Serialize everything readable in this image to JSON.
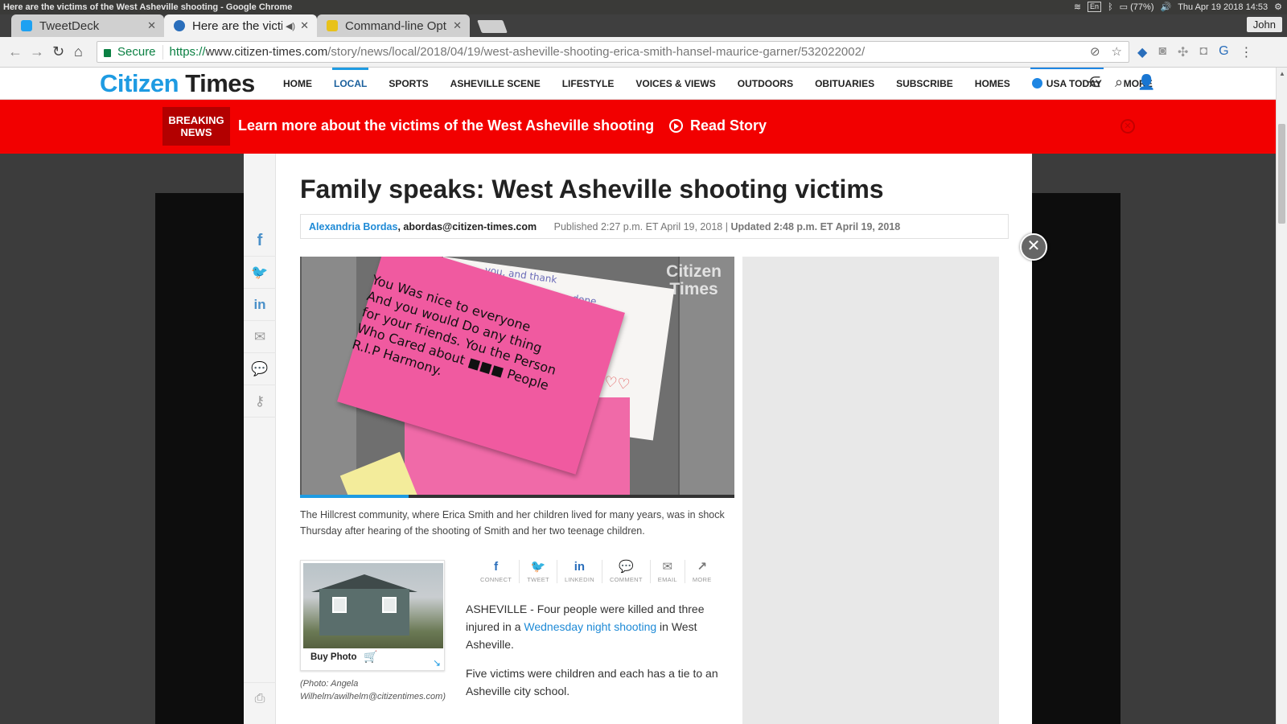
{
  "os": {
    "window_title": "Here are the victims of the West Asheville shooting - Google Chrome",
    "keyboard": "En",
    "battery": "(77%)",
    "datetime": "Thu Apr 19 2018 14:53"
  },
  "browser": {
    "tabs": [
      {
        "title": "TweetDeck",
        "active": false,
        "favicon_color": "#1da1f2"
      },
      {
        "title": "Here are the victi",
        "active": true,
        "favicon_color": "#2a6ebb"
      },
      {
        "title": "Command-line Opt",
        "active": false,
        "favicon_color": "#e8c21a"
      }
    ],
    "profile_name": "John",
    "secure_label": "Secure",
    "url_scheme": "https://",
    "url_host": "www.citizen-times.com",
    "url_path": "/story/news/local/2018/04/19/west-asheville-shooting-erica-smith-hansel-maurice-garner/532022002/"
  },
  "site": {
    "logo_part1": "Citizen",
    "logo_part2": "Times",
    "nav": [
      "HOME",
      "LOCAL",
      "SPORTS",
      "ASHEVILLE SCENE",
      "LIFESTYLE",
      "VOICES & VIEWS",
      "OUTDOORS",
      "OBITUARIES",
      "SUBSCRIBE",
      "HOMES",
      "USA TODAY",
      "MORE"
    ],
    "accent_color": "#1e9be2"
  },
  "breaking": {
    "badge_line1": "BREAKING",
    "badge_line2": "NEWS",
    "text": "Learn more about the victims of the West Asheville shooting",
    "action": "Read Story",
    "color": "#f20000"
  },
  "article": {
    "headline": "Family speaks: West Asheville shooting victims",
    "author": "Alexandria Bordas",
    "author_email": ", abordas@citizen-times.com",
    "published": "Published 2:27 p.m. ET April 19, 2018 |",
    "updated": "Updated 2:48 p.m. ET April 19, 2018",
    "video_progress": 0.25,
    "watermark_line1": "Citizen",
    "watermark_line2": "Times",
    "note_text": "You Was nice to everyone\nAnd you would Do any thing\nfor your friends. You the Person\nWho Cared about ■■■ People\nR.I.P Harmony.",
    "white_note_text": "            you, and thank\nyou for everything you've done\n to each and everyone of us.\n You would always cheer all of\n         the track meet, and\n                 would do it.\n                      kid, and\n                    ions. Hope\n                    m\n                 /2018",
    "caption": "The Hillcrest community, where Erica Smith and her children lived for many years, was in shock Thursday after hearing of the shooting of Smith and her two teenage children.",
    "buy_photo": "Buy Photo",
    "photo_credit": "(Photo: Angela Wilhelm/awilhelm@citizentimes.com)",
    "share": [
      {
        "glyph": "f",
        "label": "CONNECT"
      },
      {
        "glyph": "🐦",
        "label": "TWEET"
      },
      {
        "glyph": "in",
        "label": "LINKEDIN"
      },
      {
        "glyph": "💬",
        "label": "COMMENT"
      },
      {
        "glyph": "✉",
        "label": "EMAIL"
      },
      {
        "glyph": "↗",
        "label": "MORE"
      }
    ],
    "para1_pre": "ASHEVILLE - Four people were killed and three injured in a ",
    "para1_link": "Wednesday night shooting",
    "para1_post": " in West Asheville.",
    "para2": "Five victims were children and each has a tie to an Asheville city school."
  }
}
